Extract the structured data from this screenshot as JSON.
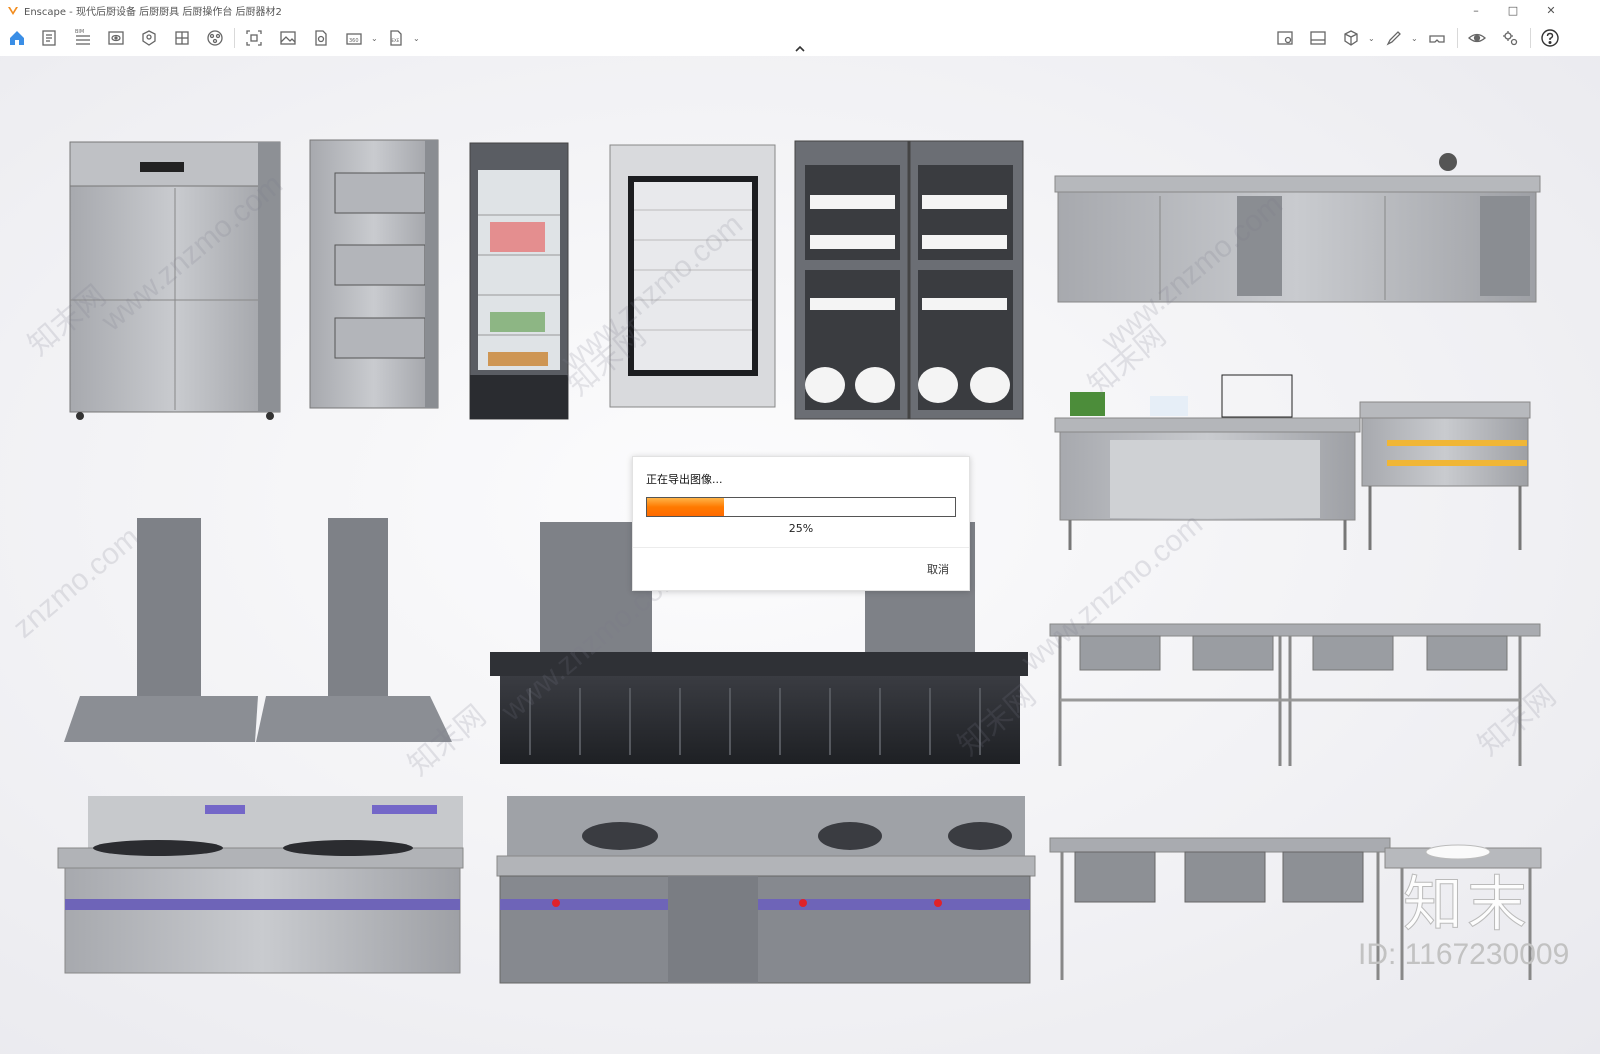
{
  "window": {
    "title": "Enscape - 现代后厨设备 后厨厨具 后厨操作台 后厨器材2",
    "accent_color": "#f28c1e"
  },
  "toolbar": {
    "left_icons": [
      "home-icon",
      "notes-icon",
      "bim-icon",
      "visual-settings-icon",
      "asset-library-icon",
      "material-editor-icon",
      "atmosphere-icon",
      "screenshot-icon",
      "render-image-icon",
      "export-icon",
      "panorama-icon",
      "exe-export-icon"
    ],
    "bim_label": "BIM",
    "pano_label": "360",
    "exe_label": "EXE",
    "right_icons": [
      "view-management-icon",
      "image-gallery-icon",
      "cube-icon",
      "pen-icon",
      "vr-headset-icon",
      "eye-icon",
      "settings-icon",
      "help-icon"
    ]
  },
  "dialog": {
    "message": "正在导出图像...",
    "progress": 0.25,
    "progress_label": "25%",
    "cancel_label": "取消",
    "progress_color": "#ff7a00"
  },
  "watermarks": {
    "site": "www.znzmo.com",
    "site_short": "znzmo.com",
    "brand_cn": "知末网",
    "big_logo": "知末",
    "id_text": "ID: 1167230009"
  }
}
